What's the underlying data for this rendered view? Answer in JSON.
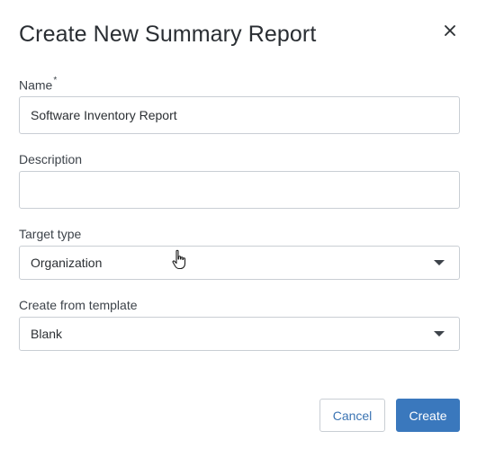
{
  "dialog": {
    "title": "Create New Summary Report",
    "close_icon": "close-icon"
  },
  "fields": {
    "name": {
      "label": "Name",
      "required_mark": "*",
      "value": "Software Inventory Report"
    },
    "description": {
      "label": "Description",
      "value": ""
    },
    "target_type": {
      "label": "Target type",
      "value": "Organization"
    },
    "template": {
      "label": "Create from template",
      "value": "Blank"
    }
  },
  "buttons": {
    "cancel": "Cancel",
    "create": "Create"
  },
  "colors": {
    "primary": "#3a78bd",
    "link": "#3b74b3",
    "border": "#c9ced4"
  }
}
